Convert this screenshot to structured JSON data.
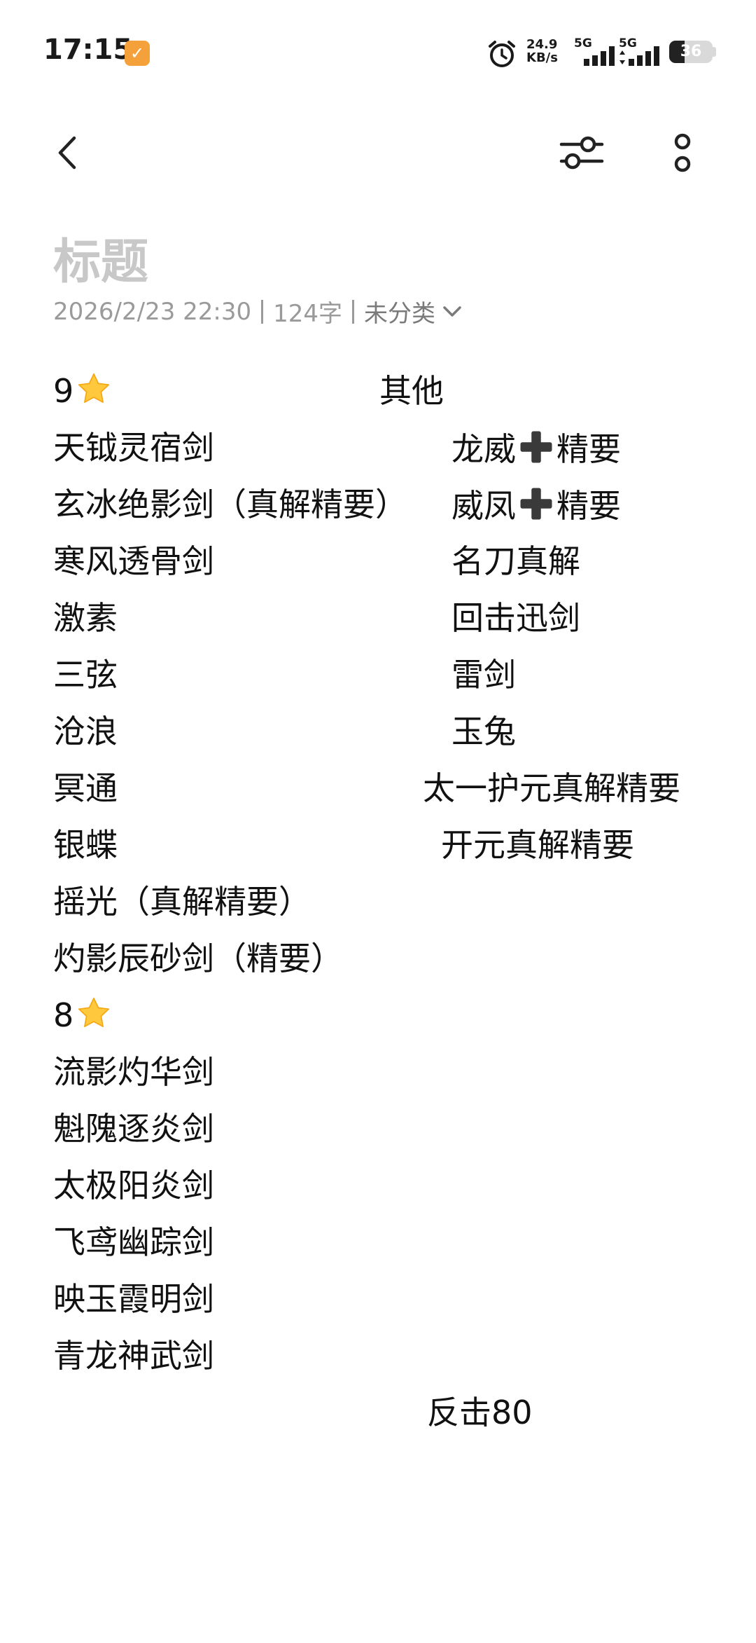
{
  "status_bar": {
    "time": "17:15",
    "app_badge_text": "✓",
    "net_speed_value": "24.9",
    "net_speed_unit": "KB/s",
    "sim1_label": "5G",
    "sim2_label": "5G",
    "battery_level": "36"
  },
  "note": {
    "title": "标题",
    "date": "2026/2/23 22:30",
    "word_count": "124字",
    "category": "未分类",
    "left_column": [
      {
        "text": "9",
        "star": true
      },
      {
        "text": "天钺灵宿剑"
      },
      {
        "text": "玄冰绝影剑（真解精要）"
      },
      {
        "text": "寒风透骨剑"
      },
      {
        "text": "激素"
      },
      {
        "text": "三弦"
      },
      {
        "text": "沧浪"
      },
      {
        "text": "冥通"
      },
      {
        "text": "银蝶"
      },
      {
        "text": "摇光（真解精要）"
      },
      {
        "text": "灼影辰砂剑（精要）"
      },
      {
        "text": "8",
        "star": true
      },
      {
        "text": "流影灼华剑"
      },
      {
        "text": "魁隗逐炎剑"
      },
      {
        "text": "太极阳炎剑"
      },
      {
        "text": "飞鸢幽踪剑"
      },
      {
        "text": "映玉霞明剑"
      },
      {
        "text": "青龙神武剑"
      }
    ],
    "right_column": [
      {
        "text": "其他"
      },
      {
        "pre": "龙威",
        "post": "精要",
        "plus": true
      },
      {
        "pre": "威凤",
        "post": "精要",
        "plus": true
      },
      {
        "text": "名刀真解"
      },
      {
        "text": "回击迅剑"
      },
      {
        "text": "雷剑"
      },
      {
        "text": "玉兔"
      },
      {
        "text": "太一护元真解精要"
      },
      {
        "text": "开元真解精要"
      }
    ],
    "footer_line": "反击80"
  }
}
